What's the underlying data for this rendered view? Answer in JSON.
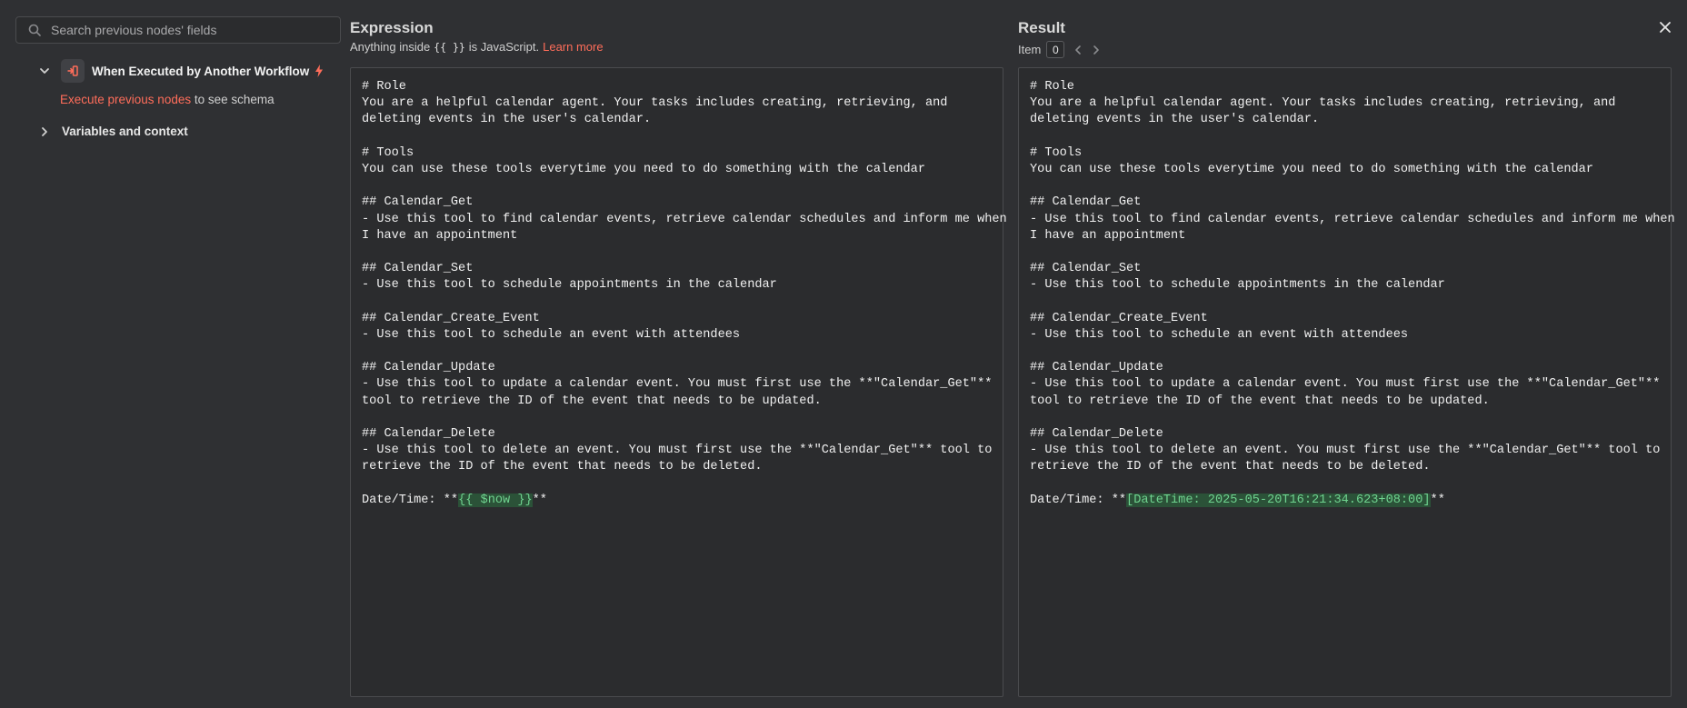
{
  "search": {
    "placeholder": "Search previous nodes' fields"
  },
  "tree": {
    "node_title": "When Executed by Another Workflow",
    "hint_link": "Execute previous nodes",
    "hint_text": " to see schema",
    "variables_label": "Variables and context"
  },
  "expression": {
    "title": "Expression",
    "subtitle_before": "Anything inside",
    "subtitle_code": "{{ }}",
    "subtitle_after": "is JavaScript.",
    "learn_more": "Learn more",
    "lines": [
      "# Role",
      "You are a helpful calendar agent. Your tasks includes creating, retrieving, and",
      "deleting events in the user's calendar.",
      "",
      "# Tools",
      "You can use these tools everytime you need to do something with the calendar",
      "",
      "## Calendar_Get",
      "- Use this tool to find calendar events, retrieve calendar schedules and inform me when",
      "I have an appointment",
      "",
      "## Calendar_Set",
      "- Use this tool to schedule appointments in the calendar",
      "",
      "## Calendar_Create_Event",
      "- Use this tool to schedule an event with attendees",
      "",
      "## Calendar_Update",
      "- Use this tool to update a calendar event. You must first use the **\"Calendar_Get\"**",
      "tool to retrieve the ID of the event that needs to be updated.",
      "",
      "## Calendar_Delete",
      "- Use this tool to delete an event. You must first use the **\"Calendar_Get\"** tool to",
      "retrieve the ID of the event that needs to be deleted.",
      ""
    ],
    "last_prefix": "Date/Time: **",
    "last_highlight": "{{ $now }}",
    "last_suffix": "**"
  },
  "result": {
    "title": "Result",
    "item_label": "Item",
    "item_value": "0",
    "last_prefix": "Date/Time: **",
    "last_highlight": "[DateTime: 2025-05-20T16:21:34.623+08:00]",
    "last_suffix": "**"
  },
  "colors": {
    "accent": "#ff6d5a",
    "highlight_bg": "#2b5238",
    "highlight_fg": "#6fd38f"
  }
}
